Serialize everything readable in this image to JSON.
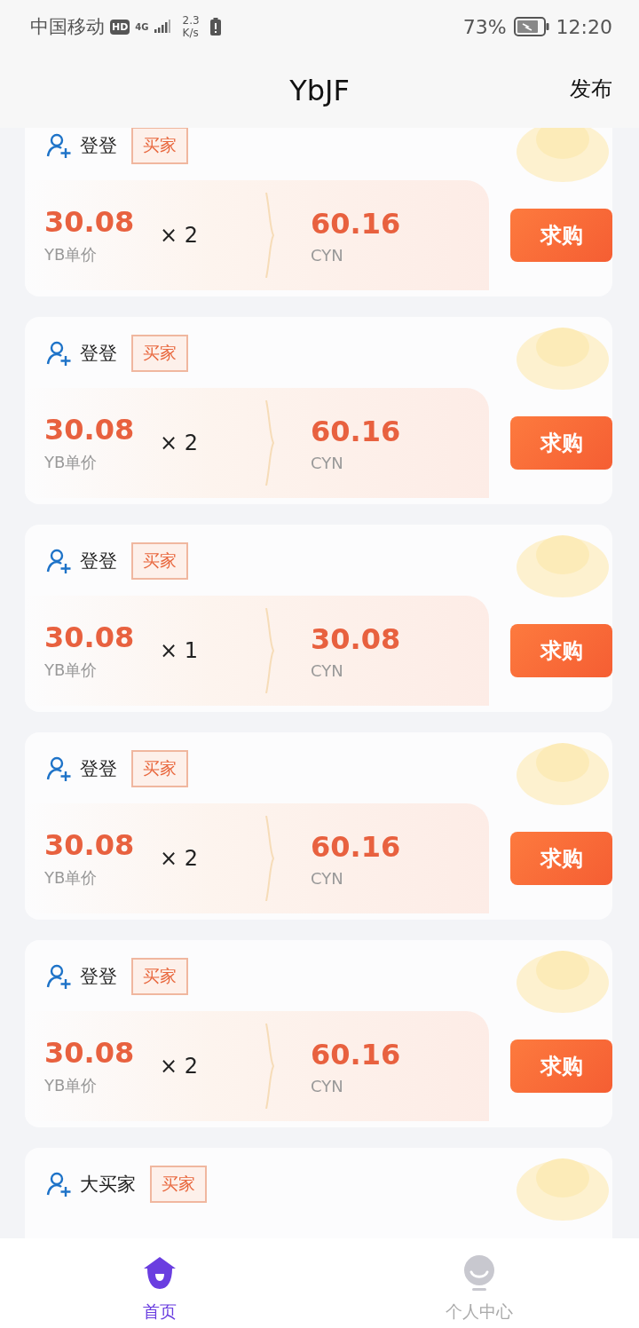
{
  "status_bar": {
    "carrier": "中国移动",
    "hd_badge": "HD",
    "network": "4G",
    "speed_value": "2.3",
    "speed_unit": "K/s",
    "battery": "73%",
    "time": "12:20"
  },
  "header": {
    "title": "YbJF",
    "action": "发布"
  },
  "listings": [
    {
      "user": "登登",
      "tag": "买家",
      "unit_price": "30.08",
      "unit_price_label": "YB单价",
      "quantity": "× 2",
      "total": "60.16",
      "currency": "CYN",
      "button": "求购"
    },
    {
      "user": "登登",
      "tag": "买家",
      "unit_price": "30.08",
      "unit_price_label": "YB单价",
      "quantity": "× 2",
      "total": "60.16",
      "currency": "CYN",
      "button": "求购"
    },
    {
      "user": "登登",
      "tag": "买家",
      "unit_price": "30.08",
      "unit_price_label": "YB单价",
      "quantity": "× 1",
      "total": "30.08",
      "currency": "CYN",
      "button": "求购"
    },
    {
      "user": "登登",
      "tag": "买家",
      "unit_price": "30.08",
      "unit_price_label": "YB单价",
      "quantity": "× 2",
      "total": "60.16",
      "currency": "CYN",
      "button": "求购"
    },
    {
      "user": "登登",
      "tag": "买家",
      "unit_price": "30.08",
      "unit_price_label": "YB单价",
      "quantity": "× 2",
      "total": "60.16",
      "currency": "CYN",
      "button": "求购"
    },
    {
      "user": "大买家",
      "tag": "买家"
    }
  ],
  "nav": [
    {
      "kind": "home",
      "label": "首页",
      "selected": true
    },
    {
      "kind": "profile",
      "label": "个人中心",
      "selected": false
    }
  ]
}
